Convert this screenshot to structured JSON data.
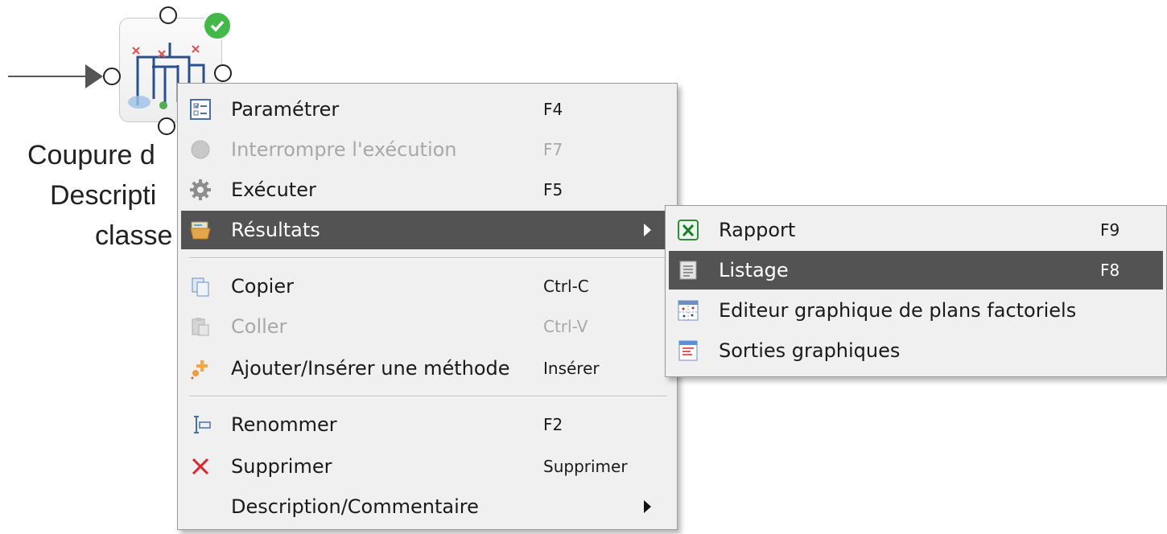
{
  "node": {
    "label_lines": [
      "Coupure d",
      "Descripti",
      "classe"
    ]
  },
  "context_menu": {
    "items": [
      {
        "label": "Paramétrer",
        "shortcut": "F4",
        "icon": "parameters-icon",
        "disabled": false
      },
      {
        "label": "Interrompre l'exécution",
        "shortcut": "F7",
        "icon": "stop-circle-icon",
        "disabled": true
      },
      {
        "label": "Exécuter",
        "shortcut": "F5",
        "icon": "gear-icon",
        "disabled": false
      },
      {
        "label": "Résultats",
        "shortcut": "",
        "icon": "results-folder-icon",
        "disabled": false,
        "highlighted": true,
        "has_submenu": true
      },
      {
        "label": "Copier",
        "shortcut": "Ctrl-C",
        "icon": "copy-icon",
        "disabled": false
      },
      {
        "label": "Coller",
        "shortcut": "Ctrl-V",
        "icon": "paste-icon",
        "disabled": true
      },
      {
        "label": "Ajouter/Insérer une méthode",
        "shortcut": "Insérer",
        "icon": "add-method-icon",
        "disabled": false
      },
      {
        "label": "Renommer",
        "shortcut": "F2",
        "icon": "rename-icon",
        "disabled": false
      },
      {
        "label": "Supprimer",
        "shortcut": "Supprimer",
        "icon": "delete-x-icon",
        "disabled": false
      },
      {
        "label": "Description/Commentaire",
        "shortcut": "",
        "icon": "",
        "disabled": false,
        "has_submenu": true
      }
    ]
  },
  "submenu": {
    "items": [
      {
        "label": "Rapport",
        "shortcut": "F9",
        "icon": "excel-report-icon"
      },
      {
        "label": "Listage",
        "shortcut": "F8",
        "icon": "listing-icon",
        "highlighted": true
      },
      {
        "label": "Editeur graphique de plans factoriels",
        "shortcut": "",
        "icon": "factorial-plot-icon"
      },
      {
        "label": "Sorties graphiques",
        "shortcut": "",
        "icon": "graphic-output-icon"
      }
    ]
  },
  "colors": {
    "menu_bg": "#f0f0f0",
    "highlight": "#535353",
    "disabled_text": "#a8a8a8",
    "delete_red": "#d9262b",
    "status_ok_green": "#43b94a"
  }
}
